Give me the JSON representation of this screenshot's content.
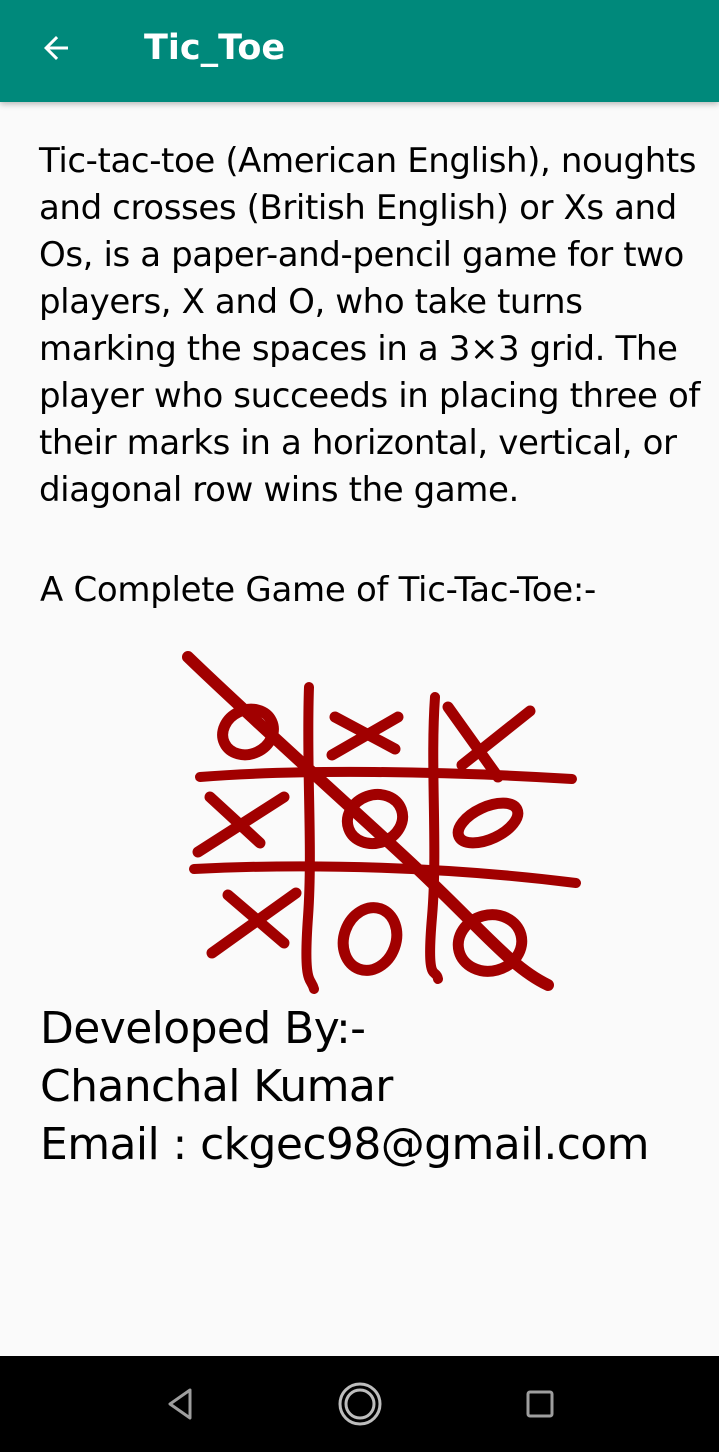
{
  "appbar": {
    "title": "Tic_Toe",
    "back_icon": "arrow-back-icon",
    "background_color": "#00897b"
  },
  "content": {
    "description": "Tic-tac-toe (American English), noughts and crosses (British English) or Xs and Os, is a paper-and-pencil game for two players, X and O, who take turns marking the spaces in a 3×3 grid. The player who succeeds in placing three of their marks in a horizontal, vertical, or diagonal row wins the game.",
    "subtitle": "A Complete Game of Tic-Tac-Toe:-",
    "image_ink_color": "#a10000",
    "credits": {
      "heading": "Developed By:-",
      "name": "Chanchal Kumar",
      "email": "Email : ckgec98@gmail.com"
    }
  },
  "navbar": {
    "icons": [
      "back-triangle-icon",
      "home-circle-icon",
      "recents-square-icon"
    ],
    "background_color": "#000000"
  }
}
